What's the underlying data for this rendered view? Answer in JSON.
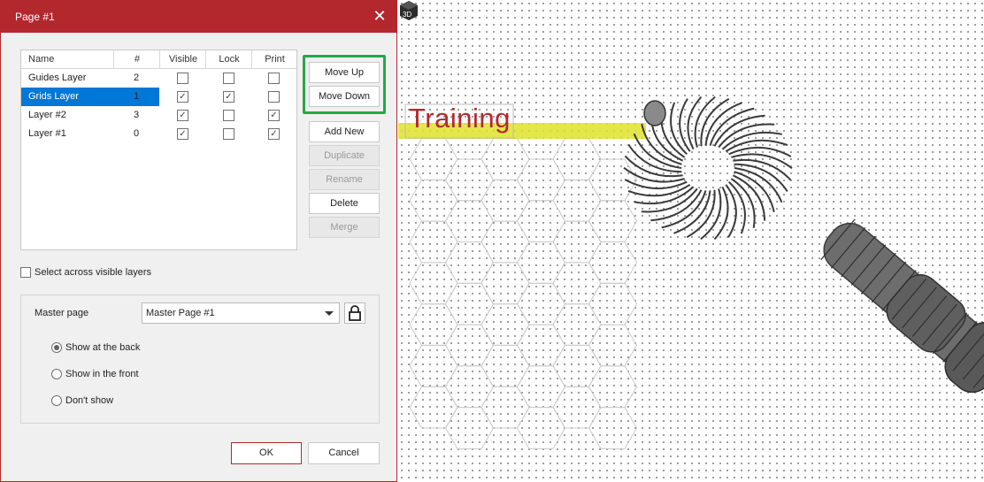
{
  "dialog": {
    "title": "Page #1",
    "close_glyph": "✕",
    "table": {
      "headers": {
        "name": "Name",
        "number": "#",
        "visible": "Visible",
        "lock": "Lock",
        "print": "Print"
      },
      "rows": [
        {
          "name": "Guides Layer",
          "number": "2",
          "visible": false,
          "lock": false,
          "print": false,
          "selected": false
        },
        {
          "name": "Grids Layer",
          "number": "1",
          "visible": true,
          "lock": true,
          "print": false,
          "selected": true
        },
        {
          "name": "Layer #2",
          "number": "3",
          "visible": true,
          "lock": false,
          "print": true,
          "selected": false
        },
        {
          "name": "Layer #1",
          "number": "0",
          "visible": true,
          "lock": false,
          "print": true,
          "selected": false
        }
      ]
    },
    "buttons": {
      "move_up": "Move Up",
      "move_down": "Move Down",
      "add_new": "Add New",
      "duplicate": "Duplicate",
      "rename": "Rename",
      "delete": "Delete",
      "merge": "Merge",
      "ok": "OK",
      "cancel": "Cancel"
    },
    "select_across": {
      "label": "Select across visible layers",
      "checked": false
    },
    "master": {
      "label": "Master page",
      "value": "Master Page #1",
      "options": [
        {
          "label": "Show at the back",
          "selected": true
        },
        {
          "label": "Show in the front",
          "selected": false
        },
        {
          "label": "Don't show",
          "selected": false
        }
      ]
    }
  },
  "canvas": {
    "label": "Training",
    "view3d_icon_text": "3D",
    "colors": {
      "accent": "#b3282d",
      "highlight": "#22a84a",
      "selection": "#0078d7",
      "yellow_line": "#dfe32a"
    }
  }
}
